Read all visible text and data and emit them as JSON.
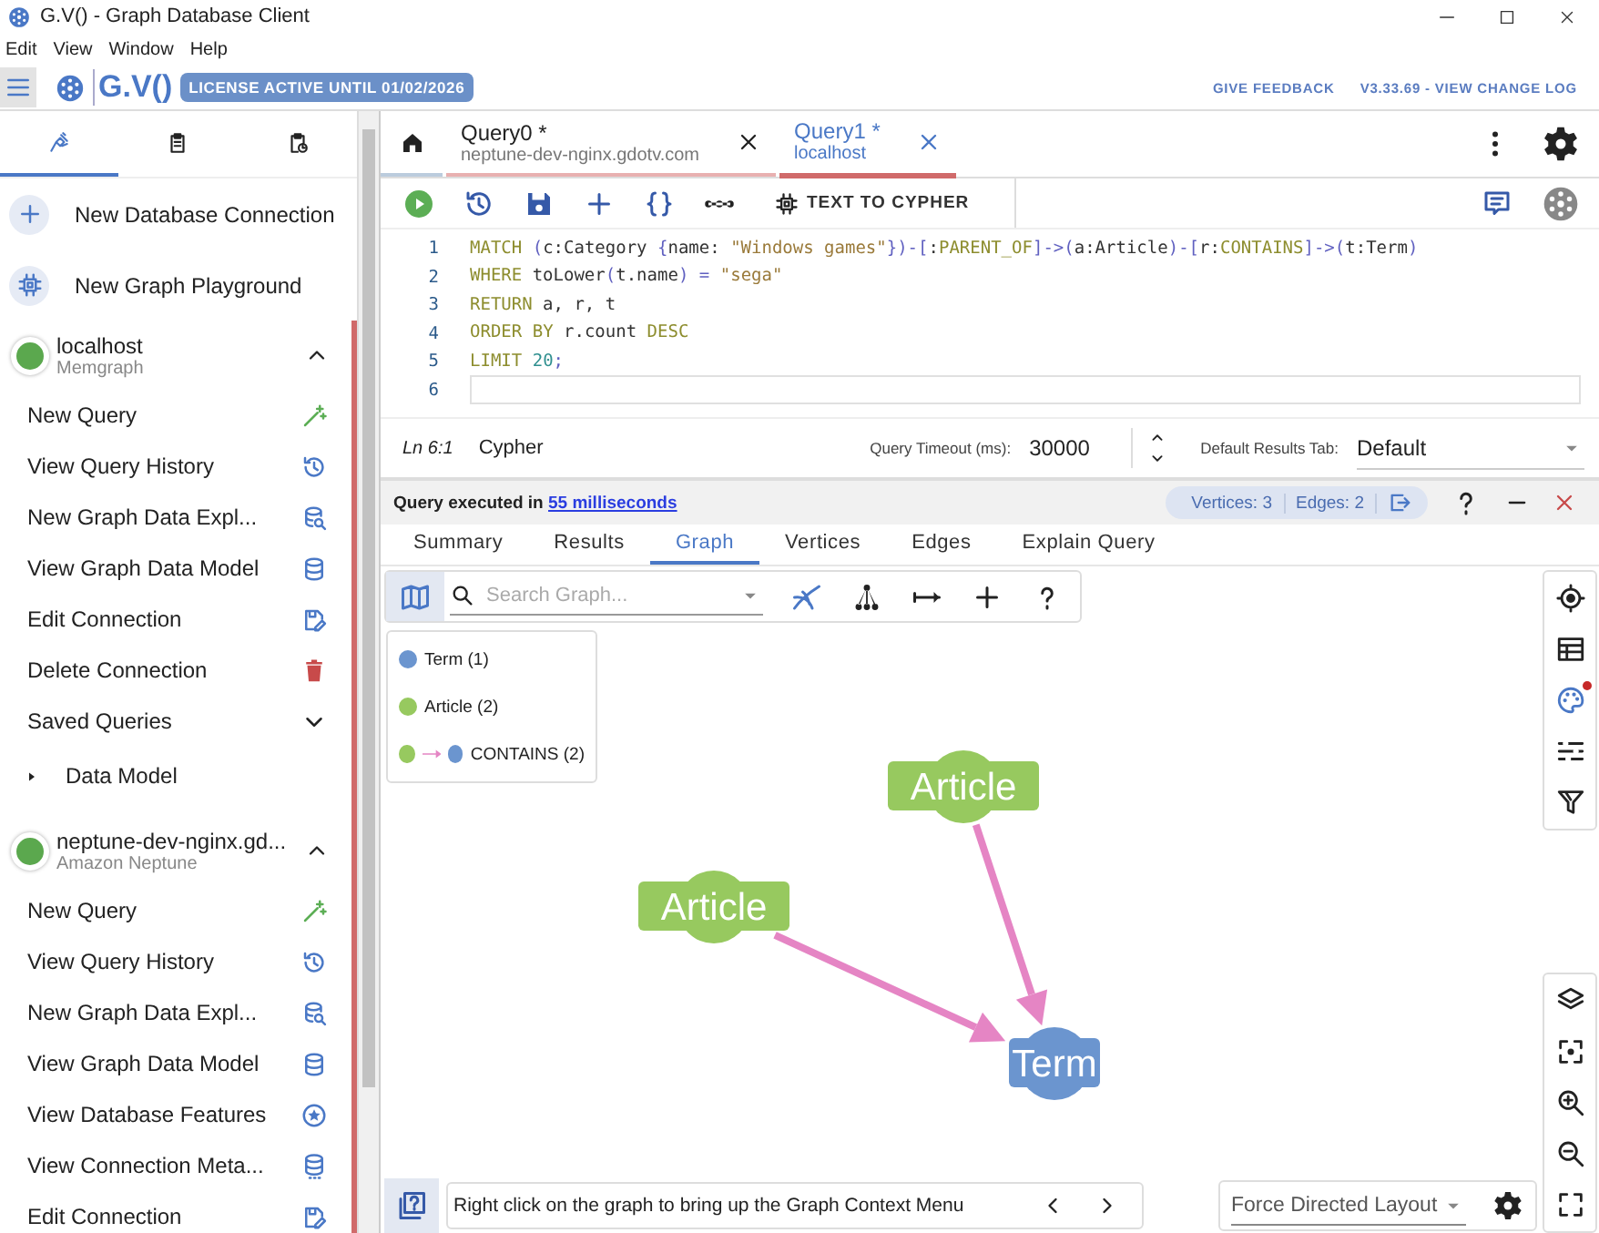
{
  "window": {
    "title": "G.V() - Graph Database Client"
  },
  "menu": [
    "Edit",
    "View",
    "Window",
    "Help"
  ],
  "header": {
    "logo": "G.V()",
    "license": "LICENSE ACTIVE UNTIL 01/02/2026",
    "links": [
      "GIVE FEEDBACK",
      "V3.33.69 - VIEW CHANGE LOG"
    ]
  },
  "sidebar": {
    "tabs": [
      {
        "kind": "connections",
        "selected": true
      },
      {
        "kind": "queries",
        "selected": false
      },
      {
        "kind": "history",
        "selected": false
      }
    ],
    "actions": [
      {
        "label": "New Database Connection",
        "kind": "add"
      },
      {
        "label": "New Graph Playground",
        "kind": "playground"
      }
    ],
    "connections": [
      {
        "name": "localhost",
        "type": "Memgraph",
        "connected": true,
        "expanded": true,
        "items": [
          {
            "label": "New Query",
            "kind": "new-query"
          },
          {
            "label": "View Query History",
            "kind": "history"
          },
          {
            "label": "New Graph Data Expl...",
            "kind": "explore"
          },
          {
            "label": "View Graph Data Model",
            "kind": "model"
          },
          {
            "label": "Edit Connection",
            "kind": "edit"
          },
          {
            "label": "Delete Connection",
            "kind": "delete"
          },
          {
            "label": "Saved Queries",
            "kind": "saved"
          },
          {
            "label": "Data Model",
            "kind": "folder",
            "expanded": false
          }
        ]
      },
      {
        "name": "neptune-dev-nginx.gd...",
        "type": "Amazon Neptune",
        "connected": true,
        "expanded": true,
        "items": [
          {
            "label": "New Query",
            "kind": "new-query"
          },
          {
            "label": "View Query History",
            "kind": "history"
          },
          {
            "label": "New Graph Data Expl...",
            "kind": "explore"
          },
          {
            "label": "View Graph Data Model",
            "kind": "model"
          },
          {
            "label": "View Database Features",
            "kind": "features"
          },
          {
            "label": "View Connection Meta...",
            "kind": "metadata"
          },
          {
            "label": "Edit Connection",
            "kind": "edit"
          }
        ]
      }
    ]
  },
  "query_tabs": [
    {
      "title": "Query0 *",
      "subtitle": "neptune-dev-nginx.gdotv.com",
      "selected": false
    },
    {
      "title": "Query1 *",
      "subtitle": "localhost",
      "selected": true
    }
  ],
  "toolbar": {
    "text_to_cypher": "TEXT TO CYPHER"
  },
  "editor": {
    "lines": [
      {
        "number": "1",
        "code": "MATCH (c:Category {name: \"Windows games\"})-[:PARENT_OF]->(a:Article)-[r:CONTAINS]->(t:Term)",
        "active": false
      },
      {
        "number": "2",
        "code": "WHERE toLower(t.name) = \"sega\"",
        "active": false
      },
      {
        "number": "3",
        "code": "RETURN a, r, t",
        "active": false
      },
      {
        "number": "4",
        "code": "ORDER BY r.count DESC",
        "active": false
      },
      {
        "number": "5",
        "code": "LIMIT 20;",
        "active": false
      },
      {
        "number": "6",
        "active": true
      }
    ]
  },
  "status": {
    "position": "Ln 6:1",
    "language": "Cypher",
    "timeout_label": "Query Timeout (ms):",
    "timeout": "30000",
    "default_tab_label": "Default Results Tab:",
    "default_tab": "Default"
  },
  "results": {
    "message": "Query executed in",
    "duration": "55 milliseconds",
    "vertices": "Vertices: 3",
    "edges": "Edges: 2",
    "tabs": [
      {
        "label": "Summary",
        "selected": false
      },
      {
        "label": "Results",
        "selected": false
      },
      {
        "label": "Graph",
        "selected": true
      },
      {
        "label": "Vertices",
        "selected": false
      },
      {
        "label": "Edges",
        "selected": false
      },
      {
        "label": "Explain Query",
        "selected": false
      }
    ]
  },
  "graph": {
    "map_selected": true,
    "search_placeholder": "Search Graph...",
    "styles_changed": true,
    "legend": [
      {
        "label": "Term (1)",
        "kind": "node",
        "color": "#6b95cf"
      },
      {
        "label": "Article (2)",
        "kind": "node",
        "color": "#97c95f"
      },
      {
        "label": "CONTAINS (2)",
        "kind": "edge",
        "color": "#e585c4"
      }
    ],
    "nodes": [
      {
        "label": "Article",
        "kind": "article",
        "color": "#97c95f"
      },
      {
        "label": "Article",
        "kind": "article",
        "color": "#97c95f"
      },
      {
        "label": "Term",
        "kind": "term",
        "color": "#6b95cf"
      }
    ],
    "hint": "Right click on the graph to bring up the Graph Context Menu",
    "layout": "Force Directed Layout"
  }
}
